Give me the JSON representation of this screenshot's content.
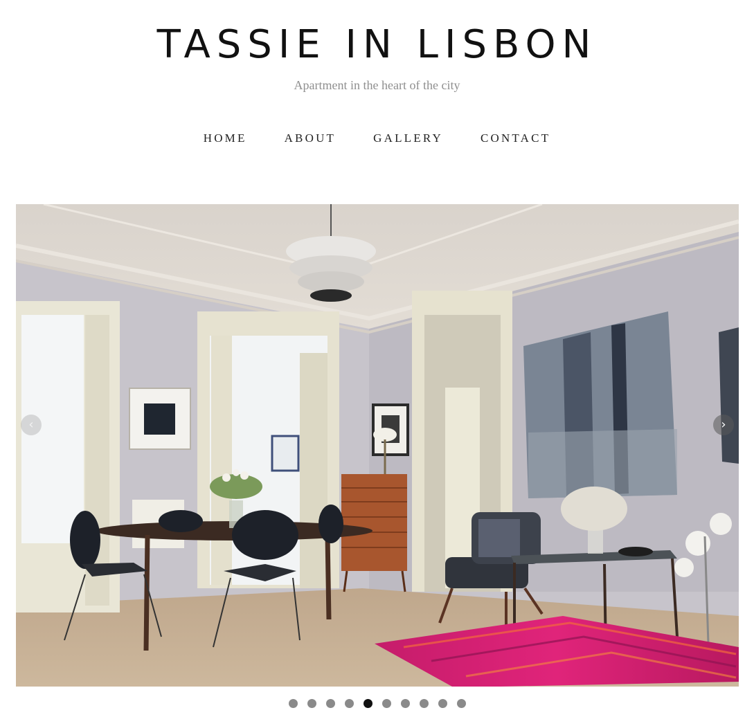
{
  "site": {
    "title": "TASSIE IN LISBON",
    "tagline": "Apartment in the heart of the city"
  },
  "nav": {
    "items": [
      {
        "label": "HOME"
      },
      {
        "label": "ABOUT"
      },
      {
        "label": "GALLERY"
      },
      {
        "label": "CONTACT"
      }
    ]
  },
  "slider": {
    "image": "living-room-photo",
    "prev_icon": "chevron-left-icon",
    "next_icon": "chevron-right-icon",
    "prev_glyph": "‹",
    "next_glyph": "›",
    "dot_count": 10,
    "active_index": 4
  },
  "colors": {
    "title": "#111111",
    "tagline": "#8f8f8f",
    "active_dot": "#111111",
    "inactive_dot": "#8a8a8a",
    "rug": "#d81f72"
  }
}
